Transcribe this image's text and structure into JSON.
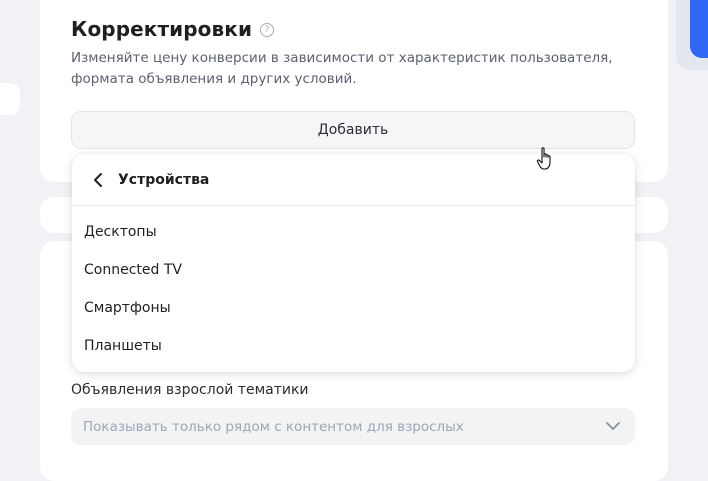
{
  "section": {
    "title": "Корректировки",
    "description": "Изменяйте цену конверсии в зависимости от характеристик пользователя, формата объявления и других условий.",
    "add_button_label": "Добавить"
  },
  "dropdown": {
    "header": "Устройства",
    "items": [
      {
        "label": "Десктопы"
      },
      {
        "label": "Connected TV"
      },
      {
        "label": "Смартфоны"
      },
      {
        "label": "Планшеты"
      }
    ]
  },
  "adult_field": {
    "label": "Объявления взрослой тематики",
    "placeholder": "Показывать только рядом с контентом для взрослых"
  },
  "colors": {
    "background": "#f0f2f5",
    "card": "#ffffff",
    "accent": "#2f68f5"
  },
  "icons": [
    "help-icon",
    "back-chevron-icon",
    "chevron-down-icon",
    "hand-cursor-icon"
  ]
}
